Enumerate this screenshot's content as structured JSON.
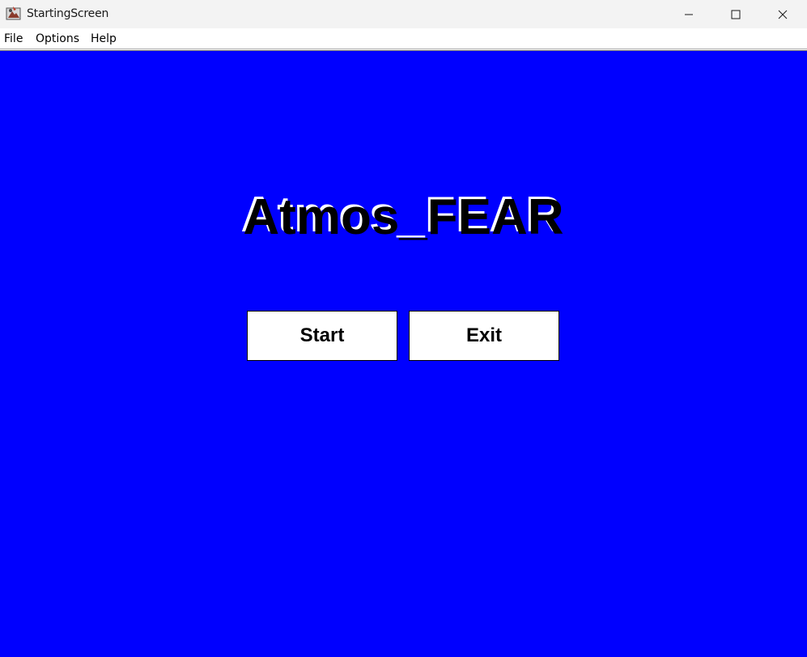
{
  "window": {
    "title": "StartingScreen",
    "app_icon": "java-app-icon",
    "controls": {
      "minimize_icon": "minimize-icon",
      "maximize_icon": "maximize-icon",
      "close_icon": "close-icon"
    }
  },
  "menubar": {
    "items": [
      {
        "label": "File"
      },
      {
        "label": "Options"
      },
      {
        "label": "Help"
      }
    ]
  },
  "screen": {
    "background_color": "#0000ff",
    "title": "Atmos_FEAR",
    "buttons": {
      "start_label": "Start",
      "exit_label": "Exit"
    }
  }
}
